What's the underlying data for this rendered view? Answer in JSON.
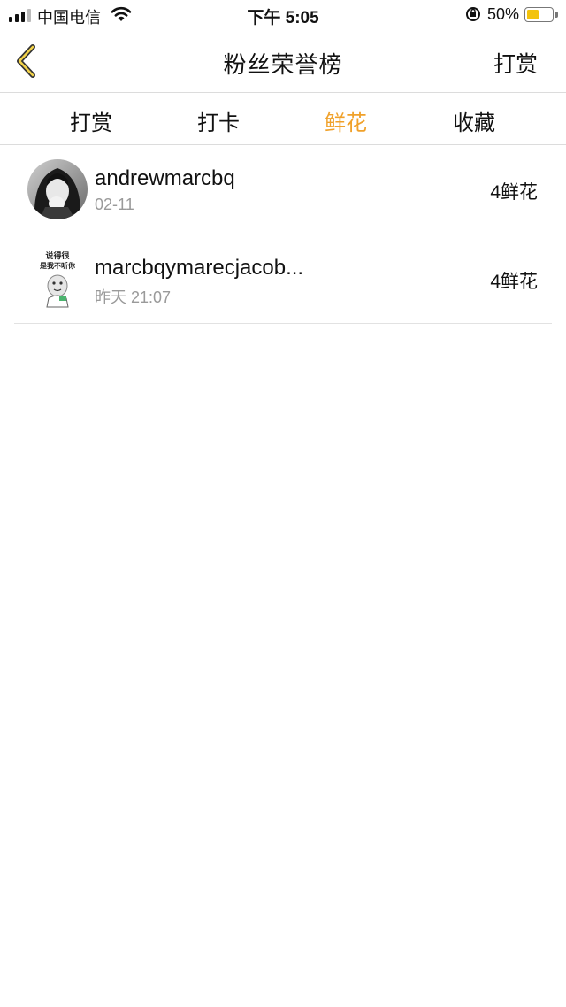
{
  "status_bar": {
    "carrier": "中国电信",
    "time": "下午 5:05",
    "battery": "50%",
    "battery_level": 0.5,
    "battery_color": "#f3c30c"
  },
  "nav": {
    "back_icon": "chevron-left-icon",
    "title": "粉丝荣誉榜",
    "right_label": "打赏"
  },
  "tabs": [
    {
      "label": "打赏",
      "active": false
    },
    {
      "label": "打卡",
      "active": false
    },
    {
      "label": "鲜花",
      "active": true
    },
    {
      "label": "收藏",
      "active": false
    }
  ],
  "accent_color": "#f0a12a",
  "list": [
    {
      "name": "andrewmarcbq",
      "sub": "02-11",
      "count": "4鲜花"
    },
    {
      "name": "marcbqymarecjacob...",
      "sub": "昨天 21:07",
      "count": "4鲜花",
      "avatar_caption_1": "说得很",
      "avatar_caption_2": "是我不听你"
    }
  ]
}
